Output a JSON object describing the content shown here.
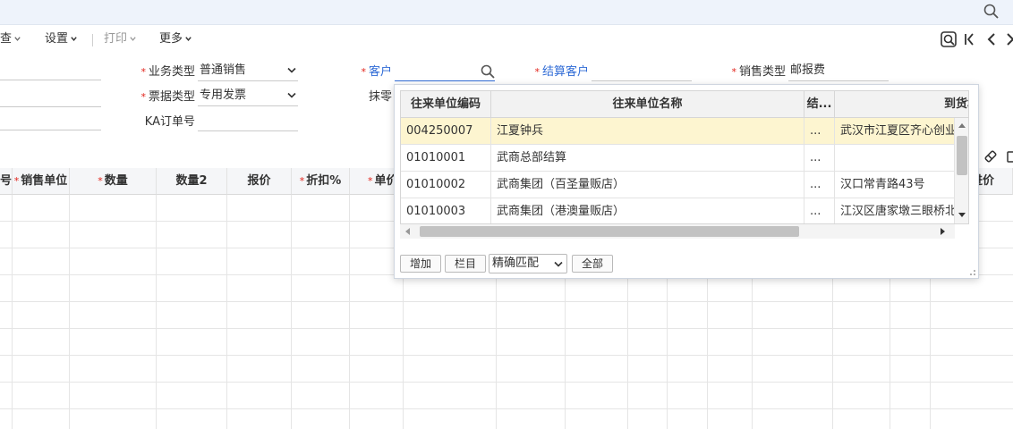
{
  "toolbar": {
    "items": [
      {
        "label": "查"
      },
      {
        "label": "设置"
      },
      {
        "label": "打印"
      },
      {
        "label": "更多"
      }
    ]
  },
  "form": {
    "business_type": {
      "label": "业务类型",
      "value": "普通销售"
    },
    "invoice_type": {
      "label": "票据类型",
      "value": "专用发票"
    },
    "ka_order": {
      "label": "KA订单号",
      "value": ""
    },
    "customer": {
      "label": "客户",
      "value": ""
    },
    "settle_customer": {
      "label": "结算客户",
      "value": ""
    },
    "rounding": {
      "label": "抹零"
    },
    "sales_type": {
      "label": "销售类型",
      "value": "邮报费"
    }
  },
  "grid": {
    "headers": [
      "号",
      "销售单位",
      "数量",
      "数量2",
      "报价",
      "折扣%",
      "单价",
      "进价"
    ]
  },
  "popup": {
    "headers": [
      "往来单位编码",
      "往来单位名称",
      "结...",
      "到货地"
    ],
    "rows": [
      {
        "code": "004250007",
        "name": "江夏钟兵",
        "settle": "...",
        "address": "武汉市江夏区齐心创业"
      },
      {
        "code": "01010001",
        "name": "武商总部结算",
        "settle": "...",
        "address": ""
      },
      {
        "code": "01010002",
        "name": "武商集团（百圣量贩店）",
        "settle": "...",
        "address": "汉口常青路43号"
      },
      {
        "code": "01010003",
        "name": "武商集团（港澳量贩店）",
        "settle": "...",
        "address": "江汉区唐家墩三眼桥北"
      }
    ],
    "buttons": {
      "add": "增加",
      "columns": "栏目",
      "match": "精确匹配",
      "all": "全部"
    }
  },
  "colors": {
    "accent": "#2f6bd6",
    "required": "#e2231a",
    "selected_row": "#fdf5d0"
  }
}
